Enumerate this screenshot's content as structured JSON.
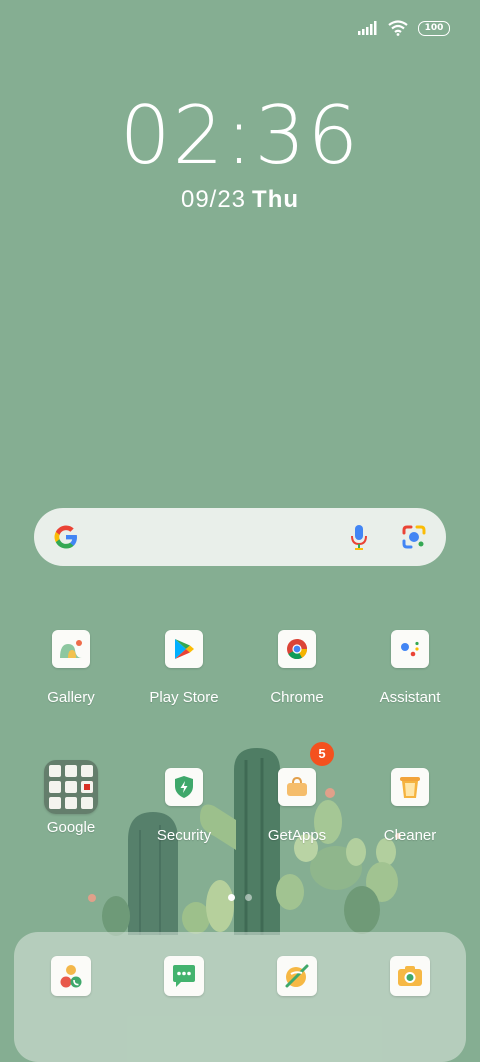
{
  "status_bar": {
    "battery_level": "100"
  },
  "lock_clock": {
    "time": "02:36",
    "date": "09/23",
    "day": "Thu"
  },
  "colors": {
    "wallpaper": "#85ae92",
    "badge": "#f4511e",
    "search_bar": "#e9efea"
  },
  "search_bar": {
    "icons": [
      "google-g-icon",
      "microphone-icon",
      "google-lens-icon"
    ]
  },
  "apps_row1": [
    {
      "label": "Gallery",
      "icon": "gallery-icon"
    },
    {
      "label": "Play Store",
      "icon": "play-store-icon"
    },
    {
      "label": "Chrome",
      "icon": "chrome-icon"
    },
    {
      "label": "Assistant",
      "icon": "assistant-icon"
    }
  ],
  "apps_row2": [
    {
      "label": "Google",
      "icon": "google-folder-icon"
    },
    {
      "label": "Security",
      "icon": "security-shield-icon"
    },
    {
      "label": "GetApps",
      "icon": "getapps-bag-icon",
      "badge": "5"
    },
    {
      "label": "Cleaner",
      "icon": "cleaner-bin-icon"
    }
  ],
  "page_indicator": {
    "count": 2,
    "active": 1
  },
  "dock": [
    {
      "icon": "phone-contacts-icon"
    },
    {
      "icon": "messages-icon"
    },
    {
      "icon": "browser-icon"
    },
    {
      "icon": "camera-icon"
    }
  ]
}
